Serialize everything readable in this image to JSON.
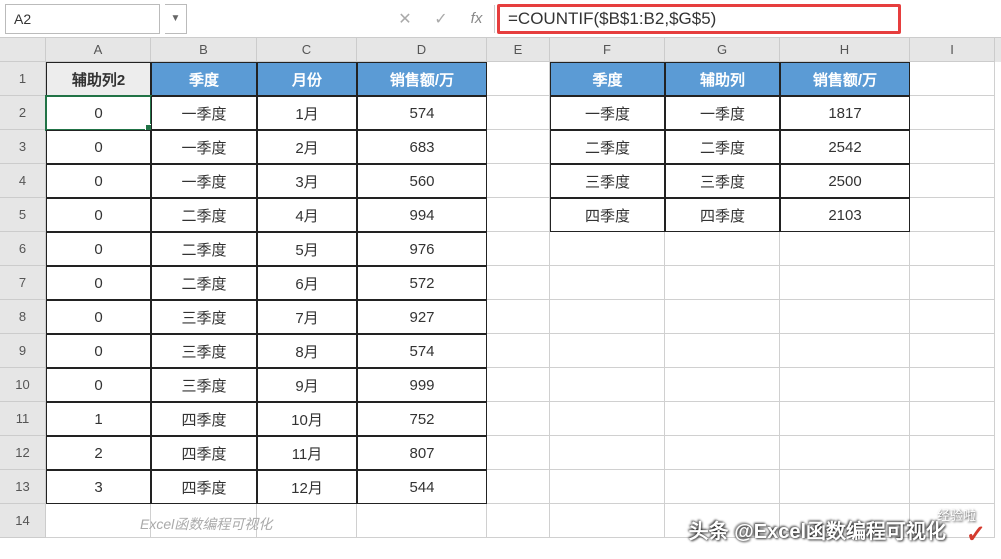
{
  "nameBox": "A2",
  "formula": "=COUNTIF($B$1:B2,$G$5)",
  "fxLabel": "fx",
  "colHeaders": [
    "A",
    "B",
    "C",
    "D",
    "E",
    "F",
    "G",
    "H",
    "I"
  ],
  "rowHeaders": [
    "1",
    "2",
    "3",
    "4",
    "5",
    "6",
    "7",
    "8",
    "9",
    "10",
    "11",
    "12",
    "13",
    "14"
  ],
  "table1": {
    "headers": [
      "辅助列2",
      "季度",
      "月份",
      "销售额/万"
    ],
    "rows": [
      [
        "0",
        "一季度",
        "1月",
        "574"
      ],
      [
        "0",
        "一季度",
        "2月",
        "683"
      ],
      [
        "0",
        "一季度",
        "3月",
        "560"
      ],
      [
        "0",
        "二季度",
        "4月",
        "994"
      ],
      [
        "0",
        "二季度",
        "5月",
        "976"
      ],
      [
        "0",
        "二季度",
        "6月",
        "572"
      ],
      [
        "0",
        "三季度",
        "7月",
        "927"
      ],
      [
        "0",
        "三季度",
        "8月",
        "574"
      ],
      [
        "0",
        "三季度",
        "9月",
        "999"
      ],
      [
        "1",
        "四季度",
        "10月",
        "752"
      ],
      [
        "2",
        "四季度",
        "11月",
        "807"
      ],
      [
        "3",
        "四季度",
        "12月",
        "544"
      ]
    ]
  },
  "table2": {
    "headers": [
      "季度",
      "辅助列",
      "销售额/万"
    ],
    "rows": [
      [
        "一季度",
        "一季度",
        "1817"
      ],
      [
        "二季度",
        "二季度",
        "2542"
      ],
      [
        "三季度",
        "三季度",
        "2500"
      ],
      [
        "四季度",
        "四季度",
        "2103"
      ]
    ]
  },
  "watermarks": {
    "w1": "Excel函数编程可视化",
    "w2": "头条 @Excel函数编程可视化",
    "w3": "✓",
    "w4": "经验啦"
  }
}
